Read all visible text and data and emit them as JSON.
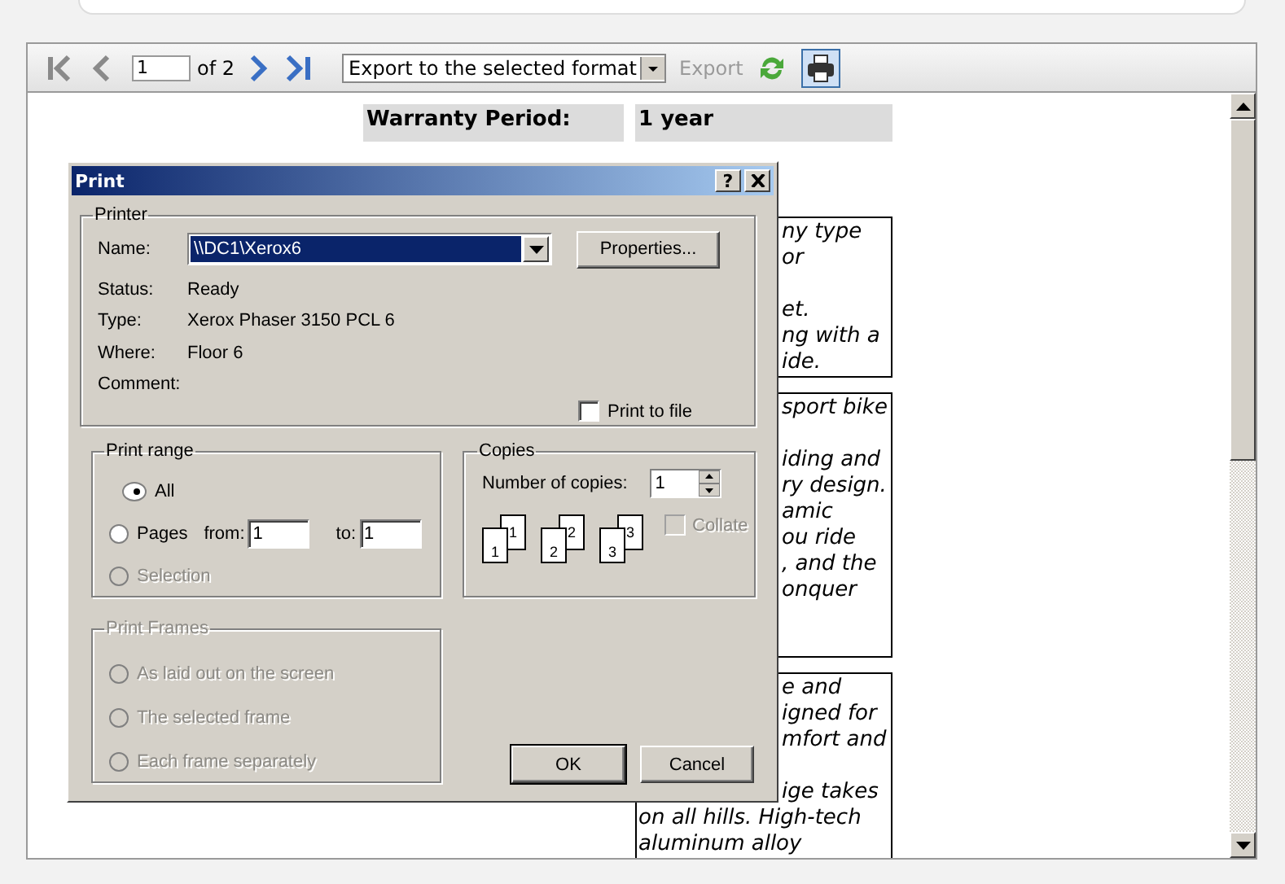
{
  "toolbar": {
    "page": "1",
    "page_count": "of 2",
    "export_format": "Export to the selected format",
    "export_label": "Export",
    "export_enabled": false
  },
  "report": {
    "warranty_label": "Warranty Period:",
    "warranty_value": "1 year",
    "boxes": [
      {
        "fragments": [
          [
            "ny type",
            "or"
          ],
          [
            "et.",
            "ng with a",
            "ide."
          ]
        ]
      },
      {
        "fragments": [
          [
            "sport bike"
          ],
          [
            "iding and",
            "ry design.",
            "amic",
            "ou ride",
            ", and the",
            "onquer"
          ]
        ]
      },
      {
        "fragments": [
          [
            "e and",
            "igned for",
            "mfort and"
          ],
          [
            "ige takes"
          ]
        ],
        "lines": [
          "on all hills. High-tech",
          "aluminum alloy"
        ]
      }
    ]
  },
  "dialog": {
    "title": "Print",
    "help": "?",
    "printer": {
      "legend": "Printer",
      "name_label": "Name:",
      "name_value": "\\\\DC1\\Xerox6",
      "properties": "Properties...",
      "info": [
        {
          "label": "Status:",
          "value": "Ready"
        },
        {
          "label": "Type:",
          "value": "Xerox Phaser 3150 PCL 6"
        },
        {
          "label": "Where:",
          "value": "Floor 6"
        },
        {
          "label": "Comment:"
        }
      ],
      "print_to_file": {
        "label": "Print to file",
        "checked": false
      }
    },
    "print_range": {
      "legend": "Print range",
      "options": [
        {
          "label": "All",
          "kind": "plain",
          "selected": true,
          "disabled": false
        },
        {
          "label": "Pages",
          "kind": "range",
          "selected": false,
          "disabled": false
        },
        {
          "label": "Selection",
          "kind": "plain",
          "selected": false,
          "disabled": true
        }
      ],
      "from_label": "from:",
      "from_value": "1",
      "to_label": "to:",
      "to_value": "1"
    },
    "copies": {
      "legend": "Copies",
      "count_label": "Number of copies:",
      "count": "1",
      "stacks": [
        {
          "front": "1",
          "back": "1"
        },
        {
          "front": "2",
          "back": "2"
        },
        {
          "front": "3",
          "back": "3"
        }
      ],
      "collate": {
        "label": "Collate",
        "checked": false,
        "disabled": true
      }
    },
    "print_frames": {
      "legend": "Print Frames",
      "disabled": true,
      "options": [
        {
          "label": "As laid out on the screen",
          "selected": false
        },
        {
          "label": "The selected frame",
          "selected": false
        },
        {
          "label": "Each frame separately",
          "selected": false
        }
      ]
    },
    "buttons": [
      "OK",
      "Cancel"
    ]
  }
}
